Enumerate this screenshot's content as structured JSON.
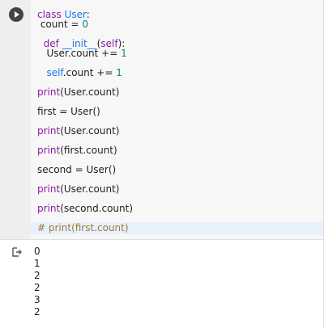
{
  "cell": {
    "run_button_label": "Run cell",
    "code_lines": [
      {
        "t": "class_line",
        "parts": [
          [
            "kw",
            "class "
          ],
          [
            "self",
            "User"
          ],
          [
            "plain",
            ":"
          ]
        ]
      },
      {
        "t": "count_line",
        "parts": [
          [
            "plain",
            " count = "
          ],
          [
            "num",
            "0"
          ]
        ]
      },
      {
        "t": "def_line",
        "parts": [
          [
            "plain",
            "  "
          ],
          [
            "kw",
            "def "
          ],
          [
            "self",
            "__init__"
          ],
          [
            "plain",
            "("
          ],
          [
            "kw",
            "self"
          ],
          [
            "plain",
            "):"
          ]
        ]
      },
      {
        "t": "inc1_line",
        "parts": [
          [
            "plain",
            "   User.count += "
          ],
          [
            "num",
            "1"
          ]
        ]
      },
      {
        "t": "inc2_line",
        "parts": [
          [
            "plain",
            "   "
          ],
          [
            "self",
            "self"
          ],
          [
            "plain",
            ".count += "
          ],
          [
            "num",
            "1"
          ]
        ]
      },
      {
        "t": "print1_line",
        "parts": [
          [
            "kw",
            "print"
          ],
          [
            "plain",
            "(User.count)"
          ]
        ]
      },
      {
        "t": "first_line",
        "parts": [
          [
            "plain",
            "first = User()"
          ]
        ]
      },
      {
        "t": "print2_line",
        "parts": [
          [
            "kw",
            "print"
          ],
          [
            "plain",
            "(User.count)"
          ]
        ]
      },
      {
        "t": "print3_line",
        "parts": [
          [
            "kw",
            "print"
          ],
          [
            "plain",
            "(first.count)"
          ]
        ]
      },
      {
        "t": "second_line",
        "parts": [
          [
            "plain",
            "second = User()"
          ]
        ]
      },
      {
        "t": "print4_line",
        "parts": [
          [
            "kw",
            "print"
          ],
          [
            "plain",
            "(User.count)"
          ]
        ]
      },
      {
        "t": "print5_line",
        "parts": [
          [
            "kw",
            "print"
          ],
          [
            "plain",
            "(second.count)"
          ]
        ]
      },
      {
        "t": "comment_line",
        "parts": [
          [
            "cm",
            "# print(first.count)"
          ]
        ]
      }
    ]
  },
  "output": {
    "icon": "output-arrow-icon",
    "lines": [
      "0",
      "1",
      "2",
      "2",
      "3",
      "2"
    ]
  }
}
